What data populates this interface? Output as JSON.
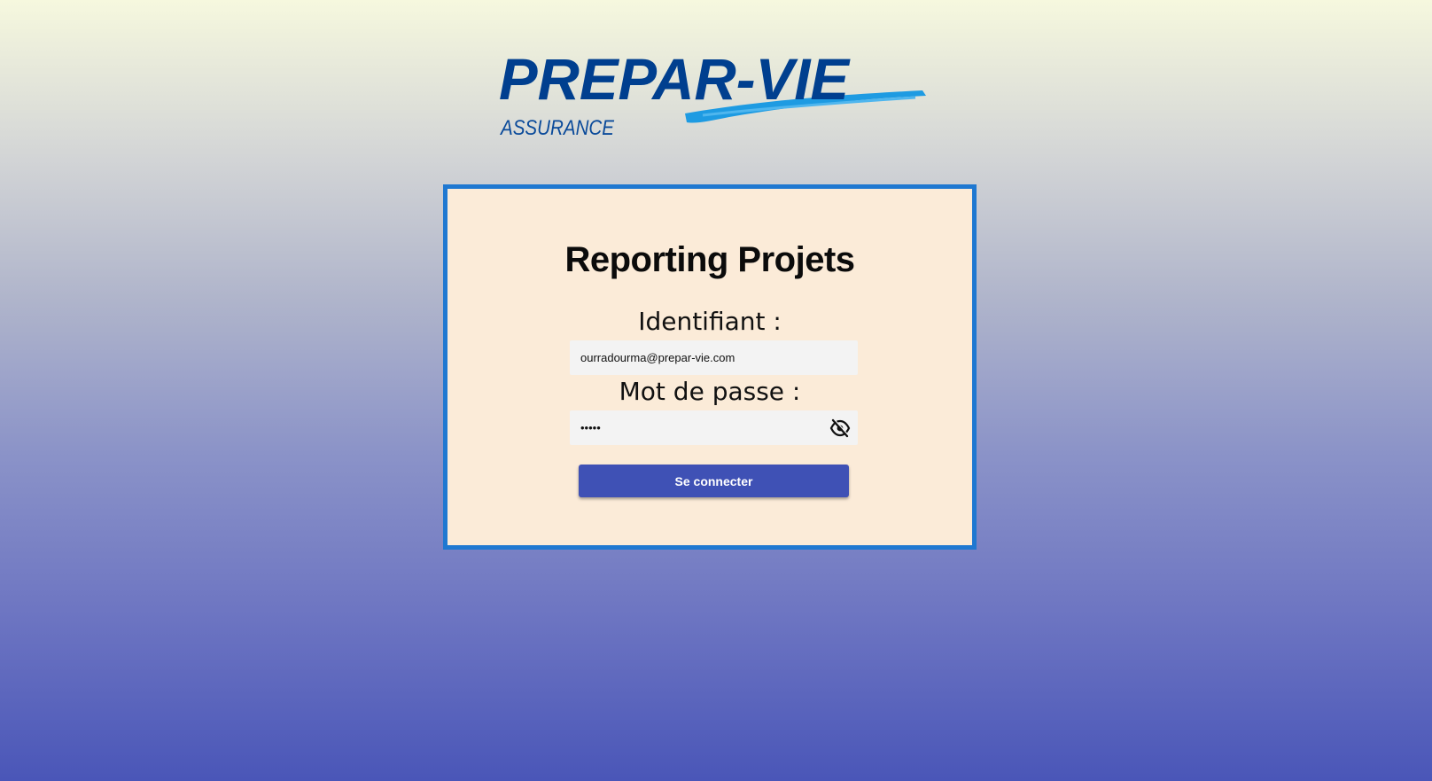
{
  "logo": {
    "brand": "PREPAR-VIE",
    "tagline": "ASSURANCE",
    "brand_color": "#003f8f",
    "swoosh_color": "#1e9be2"
  },
  "login": {
    "title": "Reporting Projets",
    "username_label": "Identifiant :",
    "username_value": "ourradourma@prepar-vie.com",
    "password_label": "Mot de passe :",
    "password_value": "•••••",
    "password_toggle_icon": "eye-off-icon",
    "submit_label": "Se connecter"
  },
  "colors": {
    "card_border": "#1f78d1",
    "card_background": "#fbebd8",
    "button": "#3f51b5"
  }
}
